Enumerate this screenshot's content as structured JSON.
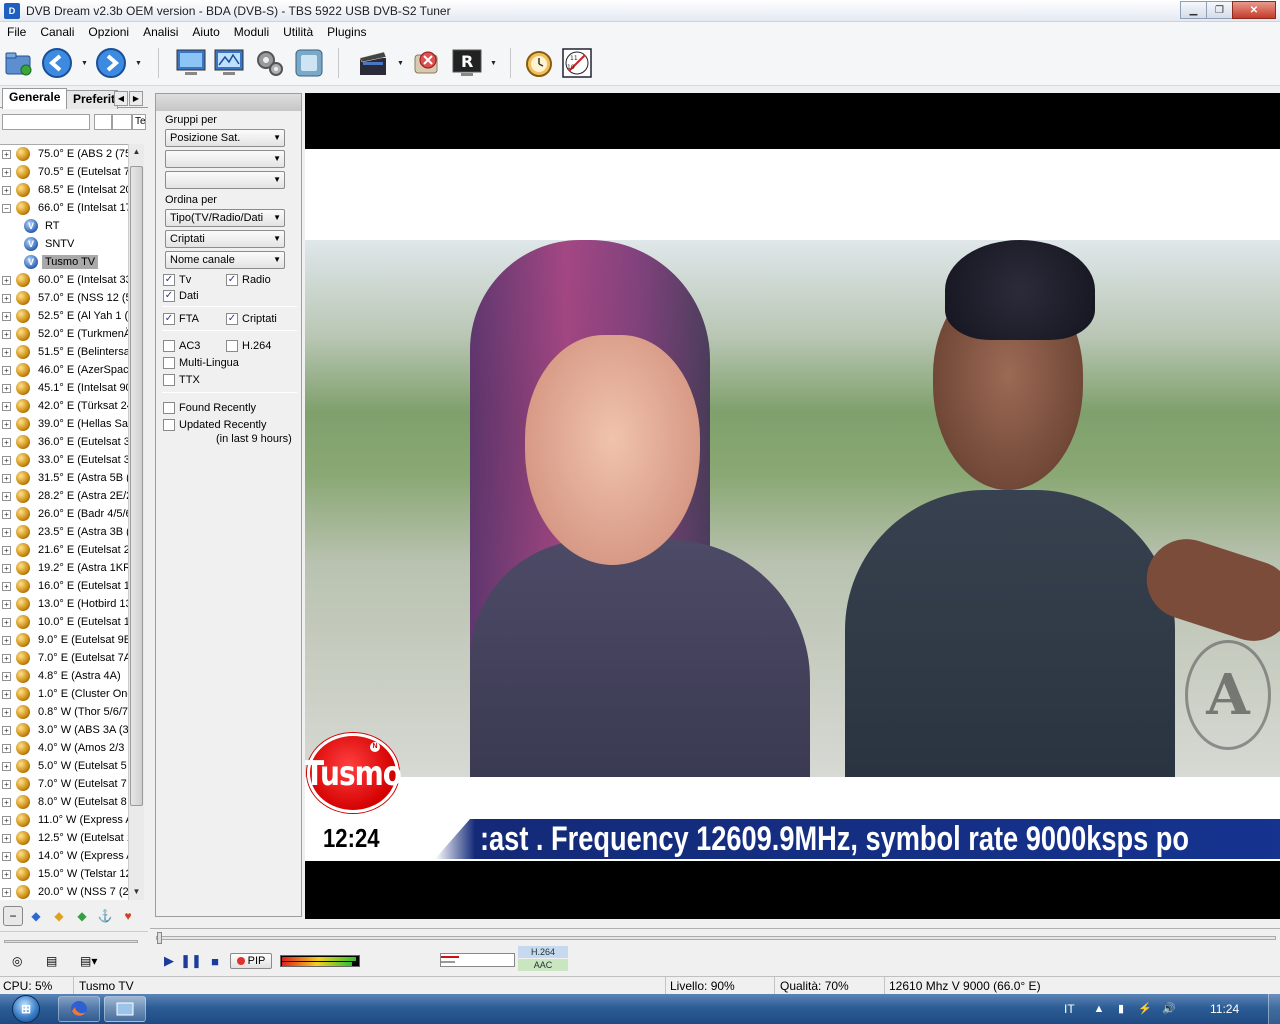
{
  "window": {
    "title": "DVB Dream v2.3b OEM version - BDA (DVB-S)  -  TBS 5922 USB DVB-S2 Tuner"
  },
  "menu": [
    "File",
    "Canali",
    "Opzioni",
    "Analisi",
    "Aiuto",
    "Moduli",
    "Utilità",
    "Plugins"
  ],
  "left_panel": {
    "tabs": [
      "Generale",
      "Preferit"
    ],
    "filter_col_label": "Te",
    "satellites": [
      {
        "label": "75.0° E (ABS 2 (75",
        "expanded": false
      },
      {
        "label": "70.5° E (Eutelsat 70",
        "expanded": false
      },
      {
        "label": "68.5° E (Intelsat 20",
        "expanded": false
      },
      {
        "label": "66.0° E (Intelsat 17",
        "expanded": true
      },
      {
        "label": "60.0° E (Intelsat 33",
        "expanded": false
      },
      {
        "label": "57.0° E (NSS 12 (5",
        "expanded": false
      },
      {
        "label": "52.5° E (Al Yah 1 (",
        "expanded": false
      },
      {
        "label": "52.0° E (TurkmenÄ",
        "expanded": false
      },
      {
        "label": "51.5° E (Belintersa",
        "expanded": false
      },
      {
        "label": "46.0° E (AzerSpac",
        "expanded": false
      },
      {
        "label": "45.1° E (Intelsat 90",
        "expanded": false
      },
      {
        "label": "42.0° E (Türksat 24",
        "expanded": false
      },
      {
        "label": "39.0° E (Hellas Sat",
        "expanded": false
      },
      {
        "label": "36.0° E (Eutelsat 36",
        "expanded": false
      },
      {
        "label": "33.0° E (Eutelsat 33",
        "expanded": false
      },
      {
        "label": "31.5° E (Astra 5B (",
        "expanded": false
      },
      {
        "label": "28.2° E (Astra 2E/2",
        "expanded": false
      },
      {
        "label": "26.0° E (Badr 4/5/6",
        "expanded": false
      },
      {
        "label": "23.5° E (Astra 3B (",
        "expanded": false
      },
      {
        "label": "21.6° E (Eutelsat 21",
        "expanded": false
      },
      {
        "label": "19.2° E (Astra 1KR",
        "expanded": false
      },
      {
        "label": "16.0° E (Eutelsat 16",
        "expanded": false
      },
      {
        "label": "13.0° E (Hotbird 13",
        "expanded": false
      },
      {
        "label": "10.0° E (Eutelsat 10",
        "expanded": false
      },
      {
        "label": "9.0° E (Eutelsat 9B",
        "expanded": false
      },
      {
        "label": "7.0° E (Eutelsat 7A",
        "expanded": false
      },
      {
        "label": "4.8° E (Astra 4A)",
        "expanded": false
      },
      {
        "label": "1.0° E (Cluster One",
        "expanded": false
      },
      {
        "label": "0.8° W (Thor 5/6/7",
        "expanded": false
      },
      {
        "label": "3.0° W (ABS 3A (3",
        "expanded": false
      },
      {
        "label": "4.0° W (Amos 2/3 (",
        "expanded": false
      },
      {
        "label": "5.0° W (Eutelsat 5",
        "expanded": false
      },
      {
        "label": "7.0° W (Eutelsat 7",
        "expanded": false
      },
      {
        "label": "8.0° W (Eutelsat 8",
        "expanded": false
      },
      {
        "label": "11.0° W (Express A",
        "expanded": false
      },
      {
        "label": "12.5° W (Eutelsat 1",
        "expanded": false
      },
      {
        "label": "14.0° W (Express A",
        "expanded": false
      },
      {
        "label": "15.0° W (Telstar 12",
        "expanded": false
      },
      {
        "label": "20.0° W (NSS 7 (2",
        "expanded": false
      }
    ],
    "channels": [
      "RT",
      "SNTV",
      "Tusmo TV"
    ],
    "selected_channel": "Tusmo TV"
  },
  "filter_panel": {
    "group_by_label": "Gruppi per",
    "group_selects": [
      "Posizione Sat.",
      "",
      ""
    ],
    "sort_by_label": "Ordina per",
    "sort_selects": [
      "Tipo(TV/Radio/Dati",
      "Criptati",
      "Nome canale"
    ],
    "checks": {
      "tv": {
        "label": "Tv",
        "checked": true
      },
      "radio": {
        "label": "Radio",
        "checked": true
      },
      "dati": {
        "label": "Dati",
        "checked": true
      },
      "fta": {
        "label": "FTA",
        "checked": true
      },
      "criptati": {
        "label": "Criptati",
        "checked": true
      },
      "ac3": {
        "label": "AC3",
        "checked": false
      },
      "h264": {
        "label": "H.264",
        "checked": false
      },
      "multilingua": {
        "label": "Multi-Lingua",
        "checked": false
      },
      "ttx": {
        "label": "TTX",
        "checked": false
      },
      "found_recently": {
        "label": "Found Recently",
        "checked": false
      },
      "updated_recently": {
        "label": "Updated Recently",
        "checked": false
      }
    },
    "updated_note": "(in last 9 hours)"
  },
  "video": {
    "logo_text": "Tusmo",
    "logo_mark": "N",
    "clock": "12:24",
    "ticker": ":ast . Frequency 12609.9MHz, symbol rate 9000ksps po"
  },
  "player": {
    "pip_label": "PIP",
    "video_codec": "H.264",
    "audio_codec": "AAC"
  },
  "status": {
    "cpu": "CPU: 5%",
    "channel": "Tusmo TV",
    "level": "Livello: 90%",
    "quality": "Qualità: 70%",
    "tuning": "12610 Mhz  V  9000  (66.0° E)"
  },
  "taskbar": {
    "language": "IT",
    "clock": "11:24"
  },
  "colors": {
    "ticker_band": "#15338f",
    "logo_red": "#d40000",
    "taskbar": "#2d5d96"
  }
}
